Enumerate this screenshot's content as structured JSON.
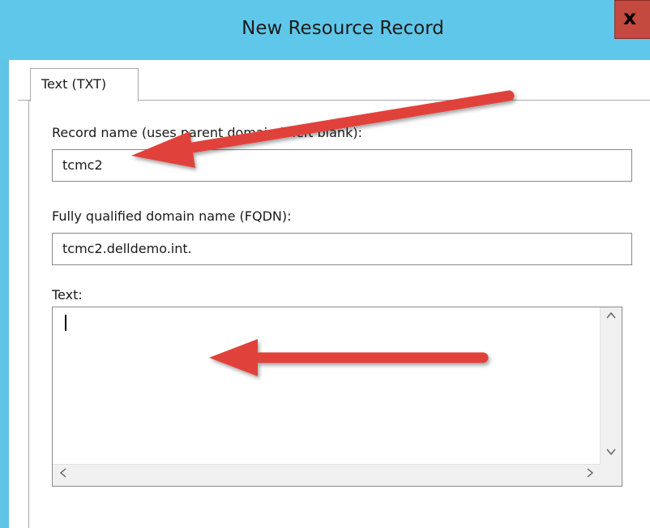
{
  "window": {
    "title": "New Resource Record",
    "close_label": "x"
  },
  "tabs": [
    {
      "label": "Text (TXT)"
    }
  ],
  "form": {
    "record_name_label": "Record name (uses parent domain if left blank):",
    "record_name_value": "tcmc2",
    "fqdn_label": "Fully qualified domain name (FQDN):",
    "fqdn_value": "tcmc2.delldemo.int.",
    "text_label": "Text:",
    "text_value": ""
  },
  "icons": {
    "scroll_up": "chevron-up-icon",
    "scroll_down": "chevron-down-icon",
    "scroll_left": "chevron-left-icon",
    "scroll_right": "chevron-right-icon",
    "annotation": "red-arrow-annotation"
  },
  "colors": {
    "titlebar": "#5fc8ea",
    "close_button": "#c4493f",
    "annotation_arrow": "#e0433b"
  }
}
